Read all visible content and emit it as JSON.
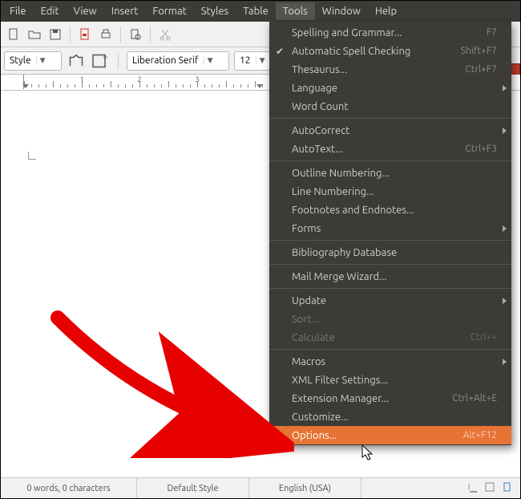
{
  "menubar": [
    "File",
    "Edit",
    "View",
    "Insert",
    "Format",
    "Styles",
    "Table",
    "Tools",
    "Window",
    "Help"
  ],
  "menubar_open_index": 7,
  "formatbar": {
    "style": "Style",
    "font": "Liberation Serif",
    "size": "12"
  },
  "ruler": {
    "numbers": [
      "1",
      "2",
      "3"
    ]
  },
  "statusbar": {
    "words": "0 words, 0 characters",
    "style": "Default Style",
    "lang": "English (USA)"
  },
  "menu": [
    {
      "type": "item",
      "label": "Spelling and Grammar...",
      "accel": "F7"
    },
    {
      "type": "item",
      "label": "Automatic Spell Checking",
      "accel": "Shift+F7",
      "checked": true
    },
    {
      "type": "item",
      "label": "Thesaurus...",
      "accel": "Ctrl+F7"
    },
    {
      "type": "item",
      "label": "Language",
      "submenu": true
    },
    {
      "type": "item",
      "label": "Word Count"
    },
    {
      "type": "sep"
    },
    {
      "type": "item",
      "label": "AutoCorrect",
      "submenu": true
    },
    {
      "type": "item",
      "label": "AutoText...",
      "accel": "Ctrl+F3"
    },
    {
      "type": "sep"
    },
    {
      "type": "item",
      "label": "Outline Numbering..."
    },
    {
      "type": "item",
      "label": "Line Numbering..."
    },
    {
      "type": "item",
      "label": "Footnotes and Endnotes..."
    },
    {
      "type": "item",
      "label": "Forms",
      "submenu": true
    },
    {
      "type": "sep"
    },
    {
      "type": "item",
      "label": "Bibliography Database"
    },
    {
      "type": "sep"
    },
    {
      "type": "item",
      "label": "Mail Merge Wizard..."
    },
    {
      "type": "sep"
    },
    {
      "type": "item",
      "label": "Update",
      "submenu": true
    },
    {
      "type": "item",
      "label": "Sort...",
      "disabled": true
    },
    {
      "type": "item",
      "label": "Calculate",
      "accel": "Ctrl++",
      "disabled": true
    },
    {
      "type": "sep"
    },
    {
      "type": "item",
      "label": "Macros",
      "submenu": true
    },
    {
      "type": "item",
      "label": "XML Filter Settings..."
    },
    {
      "type": "item",
      "label": "Extension Manager...",
      "accel": "Ctrl+Alt+E"
    },
    {
      "type": "item",
      "label": "Customize..."
    },
    {
      "type": "item",
      "label": "Options...",
      "accel": "Alt+F12",
      "highlight": true
    }
  ]
}
